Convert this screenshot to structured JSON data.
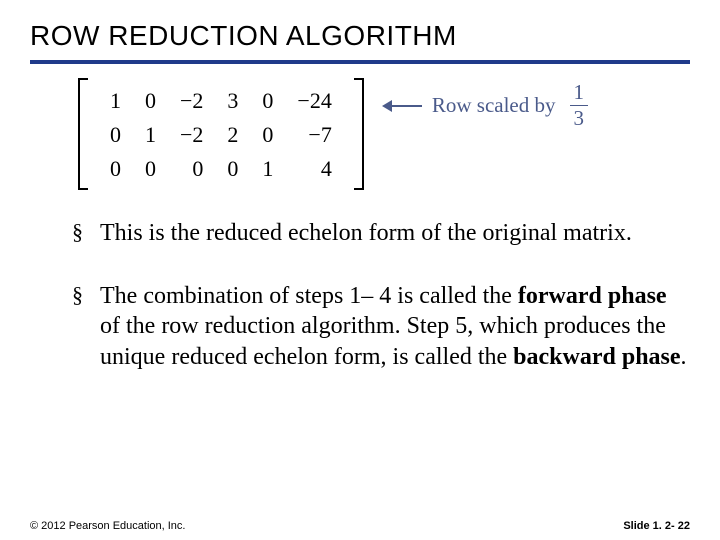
{
  "title": "ROW REDUCTION ALGORITHM",
  "matrix": {
    "rows": [
      [
        "1",
        "0",
        "−2",
        "3",
        "0",
        "−24"
      ],
      [
        "0",
        "1",
        "−2",
        "2",
        "0",
        "−7"
      ],
      [
        "0",
        "0",
        "0",
        "0",
        "1",
        "4"
      ]
    ]
  },
  "annotation": {
    "prefix": "Row scaled by",
    "frac_num": "1",
    "frac_den": "3"
  },
  "bullets": [
    {
      "text": "This is the reduced echelon form of the original matrix."
    },
    {
      "html_parts": [
        "The combination of steps 1– 4 is called the ",
        {
          "b": "forward phase"
        },
        " of the row reduction algorithm. Step 5, which produces the unique reduced echelon form, is called the ",
        {
          "b": "backward phase"
        },
        "."
      ]
    }
  ],
  "footer": {
    "left": "© 2012 Pearson Education, Inc.",
    "right": "Slide 1. 2- 22"
  }
}
